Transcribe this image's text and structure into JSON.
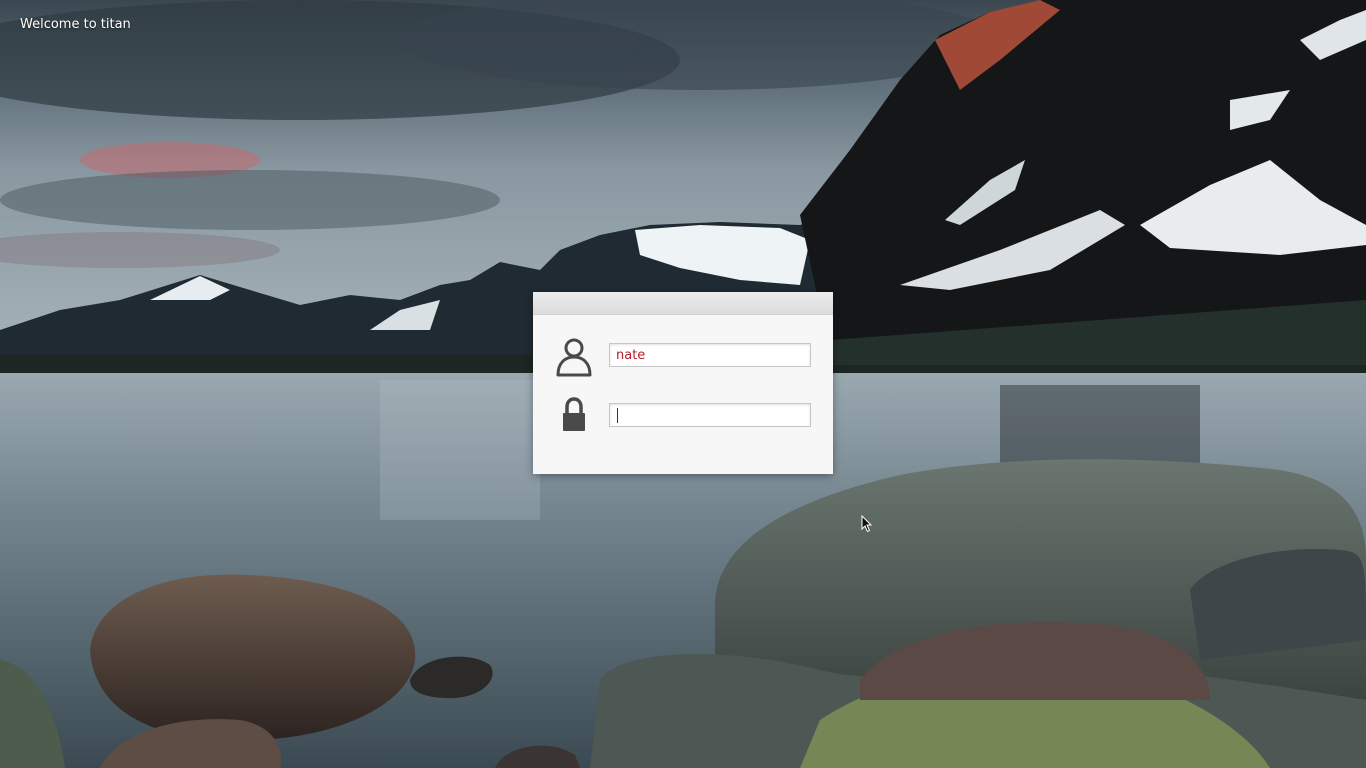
{
  "greeter": {
    "welcome_text": "Welcome to titan"
  },
  "login": {
    "username_value": "nate",
    "password_value": "",
    "user_icon": "user-icon",
    "password_icon": "lock-icon"
  },
  "colors": {
    "username_text": "#b5202a",
    "panel_background": "#f7f7f7"
  }
}
